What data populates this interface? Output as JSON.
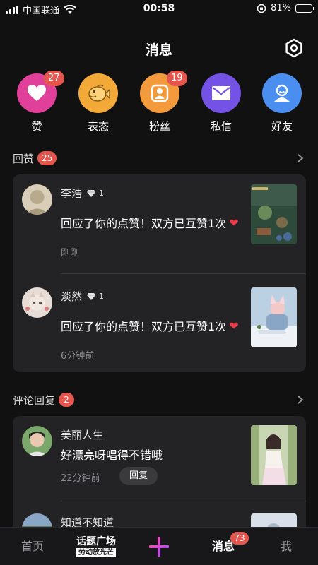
{
  "status_bar": {
    "carrier": "中国联通",
    "time": "00:58",
    "battery": "81%",
    "battery_level": 0.81
  },
  "header": {
    "title": "消息"
  },
  "quick_actions": [
    {
      "label": "赞",
      "badge": "27",
      "color": "#e0409a",
      "icon": "heart-icon"
    },
    {
      "label": "表态",
      "badge": "",
      "color": "#f2a938",
      "icon": "fish-icon"
    },
    {
      "label": "粉丝",
      "badge": "19",
      "color": "#f39b3c",
      "icon": "person-icon"
    },
    {
      "label": "私信",
      "badge": "",
      "color": "#7452e6",
      "icon": "mail-icon"
    },
    {
      "label": "好友",
      "badge": "",
      "color": "#4a8ff0",
      "icon": "friend-icon"
    }
  ],
  "likes_section": {
    "title": "回赞",
    "badge": "25",
    "items": [
      {
        "name": "李浩",
        "level": "1",
        "message": "回应了你的点赞！双方已互赞1次",
        "time": "刚刚"
      },
      {
        "name": "淡然",
        "level": "1",
        "message": "回应了你的点赞！双方已互赞1次",
        "time": "6分钟前"
      }
    ]
  },
  "comments_section": {
    "title": "评论回复",
    "badge": "2",
    "items": [
      {
        "name": "美丽人生",
        "message": "好漂亮呀唱得不错哦",
        "time": "22分钟前",
        "reply_label": "回复"
      },
      {
        "name": "知道不知道"
      }
    ]
  },
  "tab_bar": {
    "home": "首页",
    "topic_line1": "话题广场",
    "topic_line2": "劳动放光芒",
    "messages": "消息",
    "messages_badge": "73",
    "me": "我"
  }
}
